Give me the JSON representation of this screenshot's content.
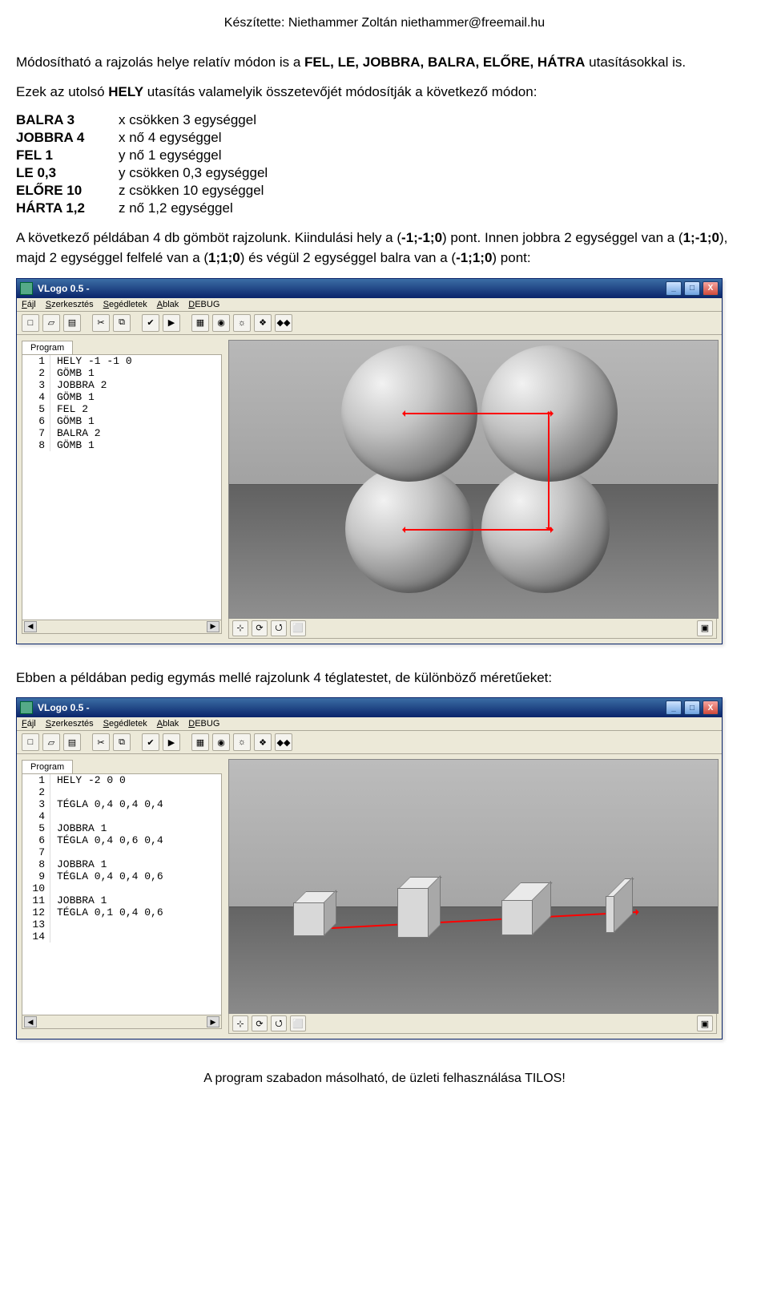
{
  "header": "Készítette: Niethammer Zoltán  niethammer@freemail.hu",
  "footer": "A program szabadon másolható, de üzleti felhasználása TILOS!",
  "para1a": "Módosítható a rajzolás helye relatív módon is a ",
  "para1b": "FEL, LE, JOBBRA, BALRA, ELŐRE, HÁTRA",
  "para1c": " utasításokkal is.",
  "para2a": "Ezek az utolsó ",
  "para2b": "HELY",
  "para2c": " utasítás valamelyik összetevőjét módosítják a következő módon:",
  "cmds": [
    {
      "c": "BALRA 3",
      "d": "x csökken 3 egységgel"
    },
    {
      "c": "JOBBRA 4",
      "d": "x nő 4 egységgel"
    },
    {
      "c": "FEL 1",
      "d": "y nő 1 egységgel"
    },
    {
      "c": "LE 0,3",
      "d": "y csökken 0,3 egységgel"
    },
    {
      "c": "ELŐRE 10",
      "d": "z csökken 10 egységgel"
    },
    {
      "c": "HÁRTA 1,2",
      "d": "z nő 1,2 egységgel"
    }
  ],
  "para3a": "A következő példában 4 db gömböt rajzolunk. Kiindulási hely a (",
  "para3b": "-1;-1;0",
  "para3c": ") pont. Innen jobbra 2 egységgel van a (",
  "para3d": "1;-1;0",
  "para3e": "), majd 2 egységgel felfelé van a (",
  "para3f": "1;1;0",
  "para3g": ") és végül 2 egységgel balra van a (",
  "para3h": "-1;1;0",
  "para3i": ") pont:",
  "para4": "Ebben a példában pedig egymás mellé rajzolunk 4 téglatestet, de különböző méretűeket:",
  "win": {
    "title": "VLogo 0.5 -",
    "menus": [
      "Fájl",
      "Szerkesztés",
      "Segédletek",
      "Ablak",
      "DEBUG"
    ],
    "tab": "Program",
    "min": "_",
    "max": "□",
    "close": "X",
    "btns": {
      "min": "_",
      "max": "□",
      "close": "X"
    }
  },
  "code1": [
    "HELY -1 -1 0",
    "GÖMB 1",
    "JOBBRA 2",
    "GÖMB 1",
    "FEL 2",
    "GÖMB 1",
    "BALRA 2",
    "GÖMB 1"
  ],
  "code2": [
    "HELY -2 0 0",
    "",
    "TÉGLA 0,4 0,4 0,4",
    "",
    "JOBBRA 1",
    "TÉGLA 0,4 0,6 0,4",
    "",
    "JOBBRA 1",
    "TÉGLA 0,4 0,4 0,6",
    "",
    "JOBBRA 1",
    "TÉGLA 0,1 0,4 0,6",
    "",
    ""
  ],
  "tb_icons": [
    "□",
    "▱",
    "▤",
    "",
    "✂",
    "⧉",
    "",
    "✔",
    "▶",
    "",
    "▦",
    "◉",
    "☼",
    "❖",
    "◆◆"
  ],
  "vp_icons": [
    "⊹",
    "⟳",
    "⭯",
    "⬜",
    "",
    "",
    "▣"
  ]
}
